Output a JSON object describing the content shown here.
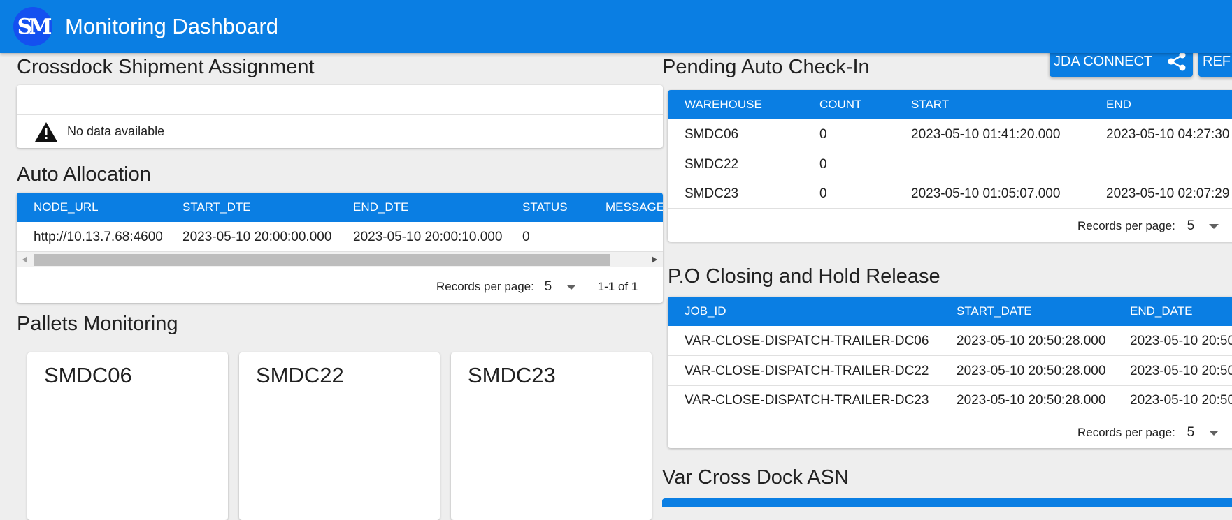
{
  "app": {
    "title": "Monitoring Dashboard",
    "logo_text": "SM"
  },
  "toolbar": {
    "jda_connect_label": "JDA CONNECT",
    "refresh_label": "REF"
  },
  "crossdock": {
    "title": "Crossdock Shipment Assignment",
    "empty_message": "No data available"
  },
  "auto_allocation": {
    "title": "Auto Allocation",
    "columns": [
      "NODE_URL",
      "START_DTE",
      "END_DTE",
      "STATUS",
      "MESSAGE"
    ],
    "rows": [
      [
        "http://10.13.7.68:4600",
        "2023-05-10 20:00:00.000",
        "2023-05-10 20:00:10.000",
        "0",
        ""
      ]
    ],
    "records_label": "Records per page:",
    "records_value": "5",
    "range": "1-1 of 1"
  },
  "pallets": {
    "title": "Pallets Monitoring",
    "cards": [
      "SMDC06",
      "SMDC22",
      "SMDC23"
    ]
  },
  "pending_checkin": {
    "title": "Pending Auto Check-In",
    "columns": [
      "WAREHOUSE",
      "COUNT",
      "START",
      "END"
    ],
    "rows": [
      [
        "SMDC06",
        "0",
        "2023-05-10 01:41:20.000",
        "2023-05-10 04:27:30"
      ],
      [
        "SMDC22",
        "0",
        "",
        ""
      ],
      [
        "SMDC23",
        "0",
        "2023-05-10 01:05:07.000",
        "2023-05-10 02:07:29"
      ]
    ],
    "records_label": "Records per page:",
    "records_value": "5"
  },
  "po_closing": {
    "title": "P.O Closing and Hold Release",
    "columns": [
      "JOB_ID",
      "START_DATE",
      "END_DATE"
    ],
    "rows": [
      [
        "VAR-CLOSE-DISPATCH-TRAILER-DC06",
        "2023-05-10 20:50:28.000",
        "2023-05-10 20:50"
      ],
      [
        "VAR-CLOSE-DISPATCH-TRAILER-DC22",
        "2023-05-10 20:50:28.000",
        "2023-05-10 20:50"
      ],
      [
        "VAR-CLOSE-DISPATCH-TRAILER-DC23",
        "2023-05-10 20:50:28.000",
        "2023-05-10 20:50"
      ]
    ],
    "records_label": "Records per page:",
    "records_value": "5"
  },
  "var_asn": {
    "title": "Var Cross Dock ASN"
  }
}
